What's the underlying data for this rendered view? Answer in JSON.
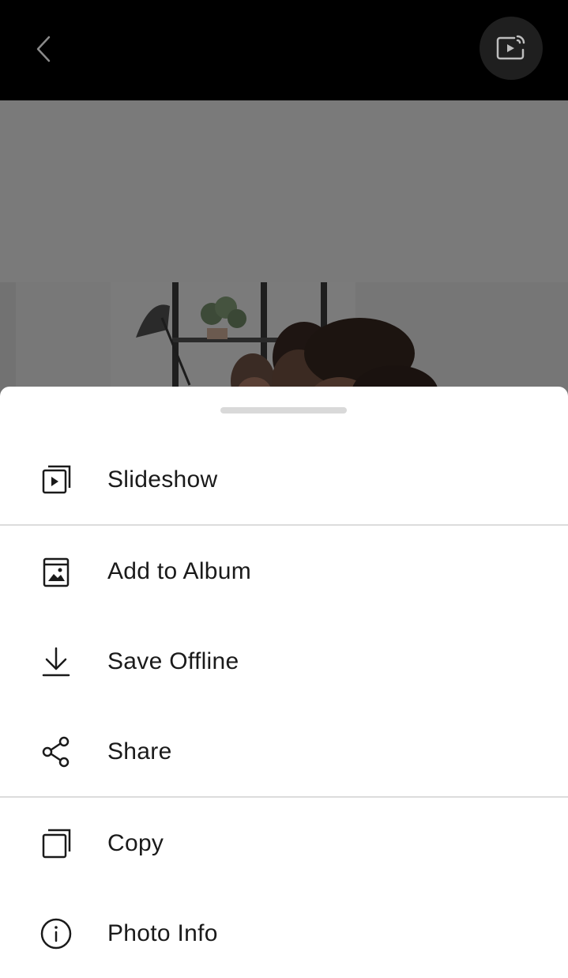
{
  "header": {
    "back_icon": "chevron-left-icon",
    "cast_icon": "cast-slideshow-icon"
  },
  "sheet": {
    "items": [
      {
        "label": "Slideshow",
        "icon": "slideshow-icon"
      },
      {
        "label": "Add to Album",
        "icon": "album-icon"
      },
      {
        "label": "Save Offline",
        "icon": "download-icon"
      },
      {
        "label": "Share",
        "icon": "share-icon"
      },
      {
        "label": "Copy",
        "icon": "copy-icon"
      },
      {
        "label": "Photo Info",
        "icon": "info-icon"
      }
    ]
  },
  "colors": {
    "topbar": "#000000",
    "sheet_background": "#ffffff",
    "text": "#1a1a1a",
    "divider": "#dcdcdc"
  }
}
